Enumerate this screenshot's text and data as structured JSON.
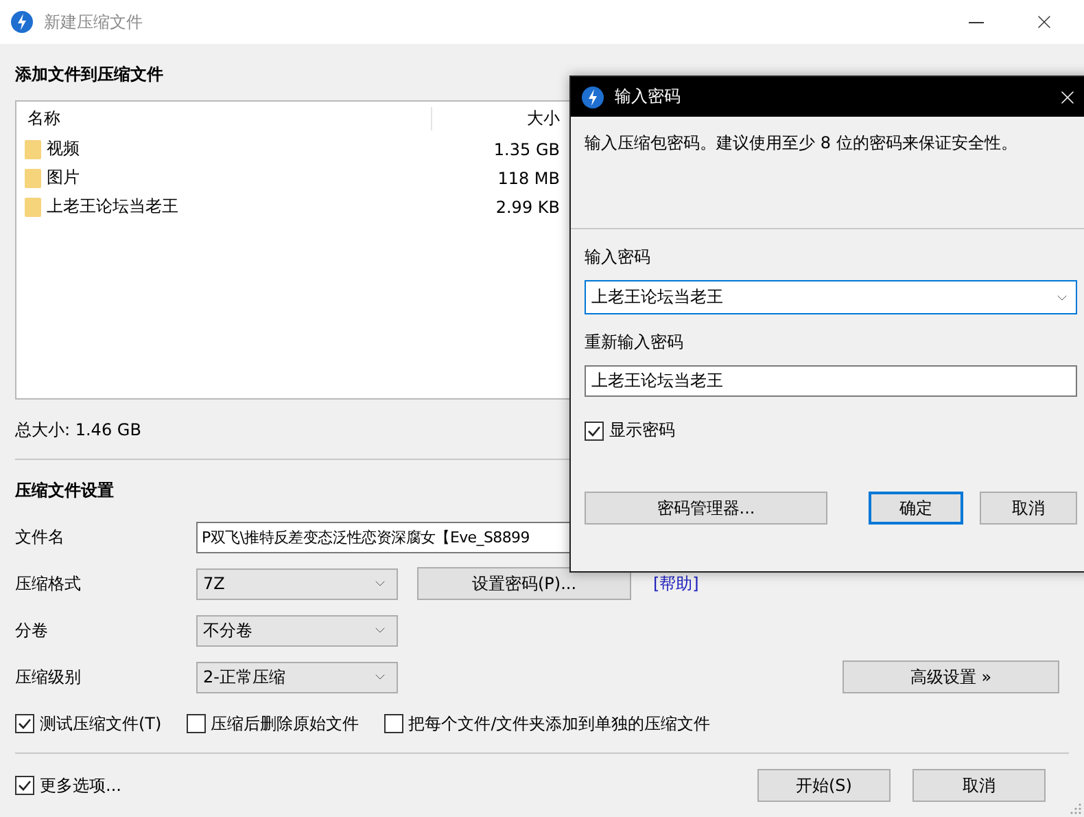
{
  "window": {
    "title": "新建压缩文件"
  },
  "files_section": {
    "title": "添加文件到压缩文件",
    "columns": [
      "名称",
      "大小"
    ],
    "rows": [
      {
        "name": "视频",
        "size": "1.35 GB"
      },
      {
        "name": "图片",
        "size": "118 MB"
      },
      {
        "name": "上老王论坛当老王",
        "size": "2.99 KB"
      }
    ],
    "total": "总大小: 1.46 GB"
  },
  "settings": {
    "title": "压缩文件设置",
    "fields": [
      {
        "kind": "text",
        "label": "文件名",
        "value": "P双飞\\推特反差变态泛性恋资深腐女【Eve_S8899"
      },
      {
        "kind": "select",
        "label": "压缩格式",
        "value": "7Z",
        "button": "设置密码(P)...",
        "link": "[帮助]"
      },
      {
        "kind": "select",
        "label": "分卷",
        "value": "不分卷"
      },
      {
        "kind": "select",
        "label": "压缩级别",
        "value": "2-正常压缩",
        "side_button": "高级设置 »"
      }
    ],
    "options": [
      {
        "label": "测试压缩文件(T)",
        "checked": true
      },
      {
        "label": "压缩后删除原始文件",
        "checked": false
      },
      {
        "label": "把每个文件/文件夹添加到单独的压缩文件",
        "checked": false
      }
    ]
  },
  "footer": {
    "more_options": {
      "label": "更多选项...",
      "checked": true
    },
    "buttons": [
      {
        "label": "开始(S)"
      },
      {
        "label": "取消"
      }
    ]
  },
  "dialog": {
    "title": "输入密码",
    "description": "输入压缩包密码。建议使用至少 8 位的密码来保证安全性。",
    "password_label": "输入密码",
    "password_value": "上老王论坛当老王",
    "confirm_label": "重新输入密码",
    "confirm_value": "上老王论坛当老王",
    "show_password": {
      "label": "显示密码",
      "checked": true
    },
    "buttons": [
      {
        "label": "密码管理器...",
        "focused": false
      },
      {
        "label": "确定",
        "focused": true
      },
      {
        "label": "取消",
        "focused": false
      }
    ]
  }
}
